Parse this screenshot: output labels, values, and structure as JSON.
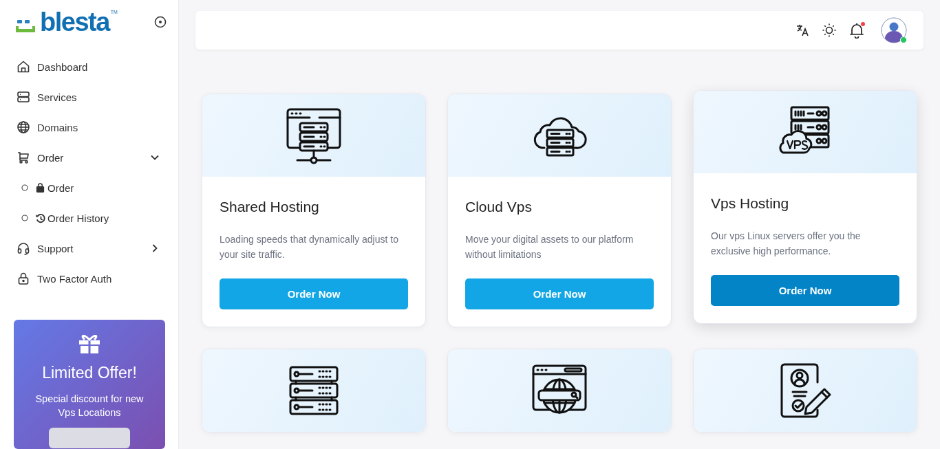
{
  "logo": {
    "text": "blesta",
    "trademark": "TM"
  },
  "sidebar": {
    "items": [
      {
        "kind": "home",
        "label": "Dashboard"
      },
      {
        "kind": "services",
        "label": "Services"
      },
      {
        "kind": "globe",
        "label": "Domains"
      },
      {
        "kind": "cart",
        "label": "Order",
        "expanded": true,
        "children": [
          {
            "kind": "bag",
            "label": "Order"
          },
          {
            "kind": "history",
            "label": "Order History"
          }
        ]
      },
      {
        "kind": "headset",
        "label": "Support",
        "expanded": false
      },
      {
        "kind": "lock",
        "label": "Two Factor Auth"
      }
    ]
  },
  "offer": {
    "title": "Limited Offer!",
    "text": "Special discount for new Vps Locations"
  },
  "topbar": {
    "notification": true,
    "online": true
  },
  "cards": [
    {
      "kind": "webserver",
      "title": "Shared Hosting",
      "description": "Loading speeds that dynamically adjust to your site traffic.",
      "button": "Order Now",
      "highlighted": false
    },
    {
      "kind": "cloud",
      "title": "Cloud Vps",
      "description": "Move your digital assets to our platform without limitations",
      "button": "Order Now",
      "highlighted": false
    },
    {
      "kind": "vps",
      "title": "Vps Hosting",
      "description": "Our vps Linux servers offer you the exclusive high performance.",
      "button": "Order Now",
      "highlighted": true
    },
    {
      "kind": "rack",
      "highlighted": false
    },
    {
      "kind": "websearch",
      "highlighted": false
    },
    {
      "kind": "contract",
      "highlighted": false
    }
  ]
}
